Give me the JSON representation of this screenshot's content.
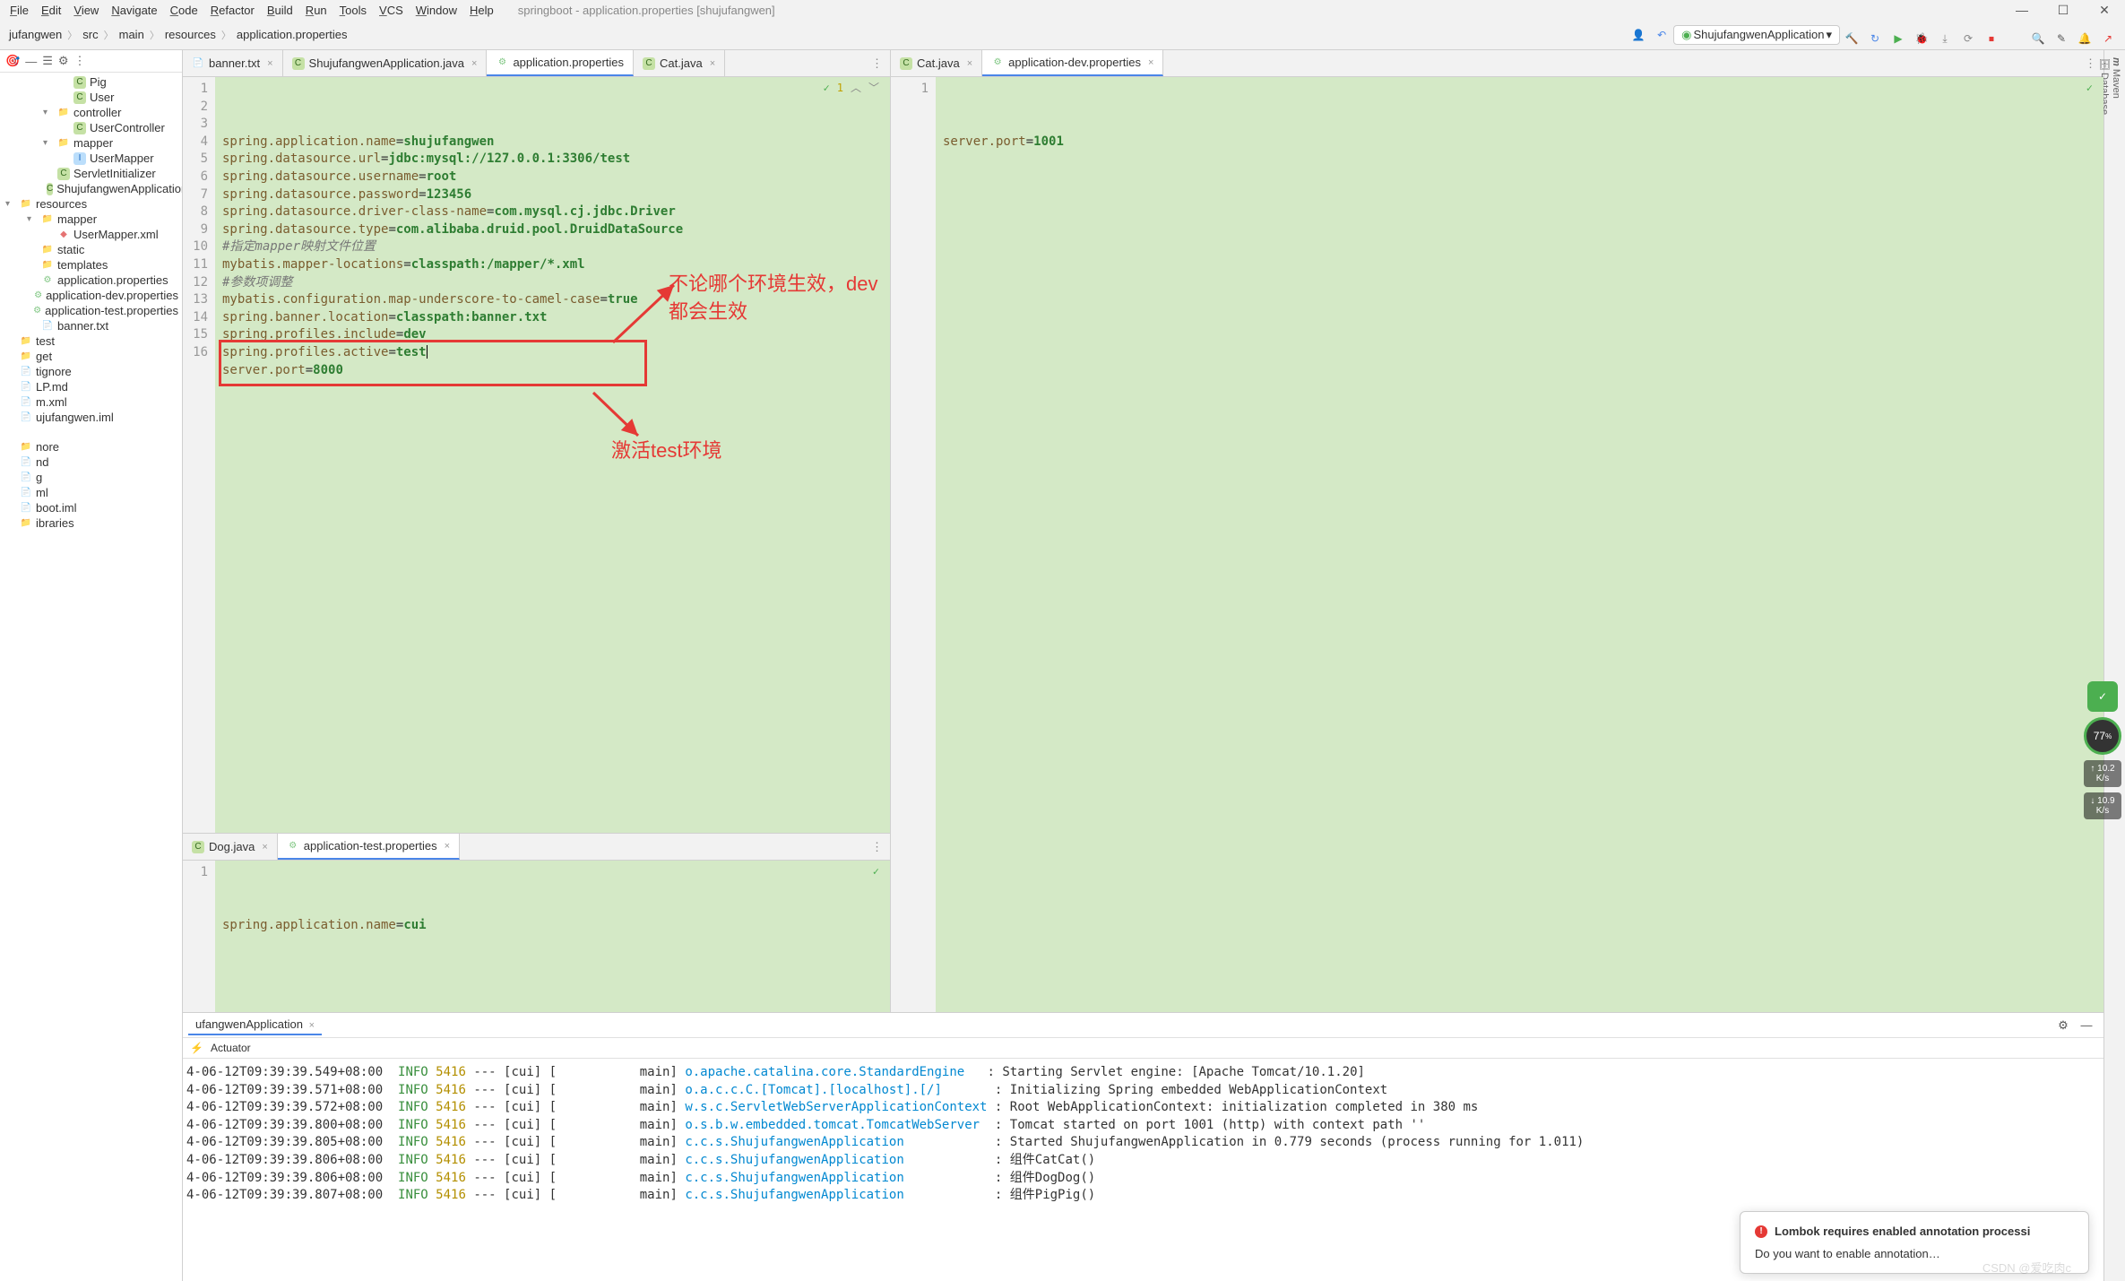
{
  "menu": {
    "items": [
      "File",
      "Edit",
      "View",
      "Navigate",
      "Code",
      "Refactor",
      "Build",
      "Run",
      "Tools",
      "VCS",
      "Window",
      "Help"
    ],
    "title": "springboot - application.properties [shujufangwen]"
  },
  "win_controls": {
    "min": "—",
    "max": "☐",
    "close": "✕"
  },
  "breadcrumbs": [
    "jufangwen",
    "src",
    "main",
    "resources",
    "application.properties"
  ],
  "run_config": {
    "icon": "▶",
    "label": "ShujufangwenApplication",
    "chev": "▾"
  },
  "tool_icons": [
    "🔨",
    "↻",
    "▶",
    "🐞",
    "⤓",
    "⟳",
    "⏹",
    "",
    "🔍",
    "✎",
    "🔔",
    "↗"
  ],
  "proj_tb": [
    "🎯",
    "—",
    "☰",
    "⚙",
    "⋮"
  ],
  "tree": [
    {
      "indent": 3,
      "chev": "",
      "icon": "C",
      "cls": "icon-class",
      "label": "Pig"
    },
    {
      "indent": 3,
      "chev": "",
      "icon": "C",
      "cls": "icon-class",
      "label": "User"
    },
    {
      "indent": 2,
      "chev": "▾",
      "icon": "📁",
      "cls": "icon-folder",
      "label": "controller"
    },
    {
      "indent": 3,
      "chev": "",
      "icon": "C",
      "cls": "icon-class",
      "label": "UserController"
    },
    {
      "indent": 2,
      "chev": "▾",
      "icon": "📁",
      "cls": "icon-folder",
      "label": "mapper"
    },
    {
      "indent": 3,
      "chev": "",
      "icon": "I",
      "cls": "icon-interface",
      "label": "UserMapper"
    },
    {
      "indent": 2,
      "chev": "",
      "icon": "C",
      "cls": "icon-class",
      "label": "ServletInitializer"
    },
    {
      "indent": 2,
      "chev": "",
      "icon": "C",
      "cls": "icon-class",
      "label": "ShujufangwenApplication"
    },
    {
      "indent": 0,
      "chev": "▾",
      "icon": "📁",
      "cls": "icon-folder",
      "label": "resources"
    },
    {
      "indent": 1,
      "chev": "▾",
      "icon": "📁",
      "cls": "icon-folder",
      "label": "mapper"
    },
    {
      "indent": 2,
      "chev": "",
      "icon": "◆",
      "cls": "icon-xml",
      "label": "UserMapper.xml"
    },
    {
      "indent": 1,
      "chev": "",
      "icon": "📁",
      "cls": "icon-folder",
      "label": "static"
    },
    {
      "indent": 1,
      "chev": "",
      "icon": "📁",
      "cls": "icon-folder",
      "label": "templates"
    },
    {
      "indent": 1,
      "chev": "",
      "icon": "⚙",
      "cls": "icon-prop",
      "label": "application.properties"
    },
    {
      "indent": 1,
      "chev": "",
      "icon": "⚙",
      "cls": "icon-prop",
      "label": "application-dev.properties"
    },
    {
      "indent": 1,
      "chev": "",
      "icon": "⚙",
      "cls": "icon-prop",
      "label": "application-test.properties"
    },
    {
      "indent": 1,
      "chev": "",
      "icon": "📄",
      "cls": "",
      "label": "banner.txt"
    },
    {
      "indent": 0,
      "chev": "",
      "icon": "📁",
      "cls": "icon-folder",
      "label": "test"
    },
    {
      "indent": 0,
      "chev": "",
      "icon": "📁",
      "cls": "icon-folder",
      "label": "get"
    },
    {
      "indent": 0,
      "chev": "",
      "icon": "📄",
      "cls": "",
      "label": "tignore"
    },
    {
      "indent": 0,
      "chev": "",
      "icon": "📄",
      "cls": "",
      "label": "LP.md"
    },
    {
      "indent": 0,
      "chev": "",
      "icon": "📄",
      "cls": "",
      "label": "m.xml"
    },
    {
      "indent": 0,
      "chev": "",
      "icon": "📄",
      "cls": "",
      "label": "ujufangwen.iml"
    },
    {
      "indent": 0,
      "chev": "",
      "icon": "",
      "cls": "",
      "label": ""
    },
    {
      "indent": 0,
      "chev": "",
      "icon": "📁",
      "cls": "icon-folder",
      "label": "nore"
    },
    {
      "indent": 0,
      "chev": "",
      "icon": "📄",
      "cls": "",
      "label": "nd"
    },
    {
      "indent": 0,
      "chev": "",
      "icon": "📄",
      "cls": "",
      "label": "g"
    },
    {
      "indent": 0,
      "chev": "",
      "icon": "📄",
      "cls": "",
      "label": "ml"
    },
    {
      "indent": 0,
      "chev": "",
      "icon": "📄",
      "cls": "",
      "label": "boot.iml"
    },
    {
      "indent": 0,
      "chev": "",
      "icon": "📁",
      "cls": "icon-folder",
      "label": "ibraries"
    }
  ],
  "tabs_left": [
    {
      "icon": "📄",
      "label": "banner.txt",
      "close": "×",
      "active": false
    },
    {
      "icon": "C",
      "label": "ShujufangwenApplication.java",
      "close": "×",
      "active": false
    },
    {
      "icon": "⚙",
      "label": "application.properties",
      "close": "",
      "active": true
    },
    {
      "icon": "C",
      "label": "Cat.java",
      "close": "×",
      "active": false
    }
  ],
  "tabs_right": [
    {
      "icon": "C",
      "label": "Cat.java",
      "close": "×",
      "active": false
    },
    {
      "icon": "⚙",
      "label": "application-dev.properties",
      "close": "×",
      "active": true
    }
  ],
  "tabs_dots": "⋮",
  "editor_main_status": {
    "check": "✓",
    "count": "1",
    "up": "︿",
    "down": "﹀"
  },
  "editor_main": {
    "gutter": [
      "1",
      "2",
      "3",
      "4",
      "5",
      "6",
      "7",
      "8",
      "9",
      "10",
      "11",
      "12",
      "13",
      "14",
      "15",
      "16"
    ],
    "lines": [
      {
        "key": "spring.application.name",
        "eq": "=",
        "val": "shujufangwen"
      },
      {
        "key": "spring.datasource.url",
        "eq": "=",
        "val": "jdbc:mysql://127.0.0.1:3306/test"
      },
      {
        "key": "spring.datasource.username",
        "eq": "=",
        "val": "root"
      },
      {
        "key": "spring.datasource.password",
        "eq": "=",
        "val": "123456"
      },
      {
        "key": "spring.datasource.driver-class-name",
        "eq": "=",
        "val": "com.mysql.cj.jdbc.Driver"
      },
      {
        "key": "spring.datasource.type",
        "eq": "=",
        "val": "com.alibaba.druid.pool.DruidDataSource"
      },
      {
        "comment": "#指定mapper映射文件位置"
      },
      {
        "key": "mybatis.mapper-locations",
        "eq": "=",
        "val": "classpath:/mapper/*.xml"
      },
      {
        "comment": "#参数项调整"
      },
      {
        "key": "mybatis.configuration.map-underscore-to-camel-case",
        "eq": "=",
        "val": "true"
      },
      {
        "key": "spring.banner.location",
        "eq": "=",
        "val": "classpath:banner.txt"
      },
      {
        "key": "spring.profiles.include",
        "eq": "=",
        "val": "dev"
      },
      {
        "key": "spring.profiles.active",
        "eq": "=",
        "val": "test",
        "cursor": true
      },
      {
        "key": "server.port",
        "eq": "=",
        "val": "8000"
      },
      {
        "blank": true
      },
      {
        "blank": true
      }
    ]
  },
  "annot": {
    "top": "不论哪个环境生效，dev都会生效",
    "bottom": "激活test环境"
  },
  "editor_right": {
    "gutter": [
      "1"
    ],
    "lines": [
      {
        "key": "server.port",
        "eq": "=",
        "val": "1001"
      }
    ]
  },
  "tabs_bottom": [
    {
      "icon": "C",
      "label": "Dog.java",
      "close": "×",
      "active": false
    },
    {
      "icon": "⚙",
      "label": "application-test.properties",
      "close": "×",
      "active": true
    }
  ],
  "editor_bottom": {
    "gutter": [
      "1"
    ],
    "lines": [
      {
        "key": "spring.application.name",
        "eq": "=",
        "val": "cui"
      }
    ]
  },
  "run_tab": {
    "label": "ufangwenApplication",
    "close": "×",
    "gear": "⚙",
    "minus": "—"
  },
  "actuator": {
    "icon": "⚡",
    "label": "Actuator"
  },
  "console_lines": [
    {
      "ts": "4-06-12T09:39:39.549+08:00",
      "lvl": "INFO",
      "pid": "5416",
      "thread": "--- [cui] [",
      "main": "           main] ",
      "logger": "o.apache.catalina.core.StandardEngine",
      "msg": "   : Starting Servlet engine: [Apache Tomcat/10.1.20]"
    },
    {
      "ts": "4-06-12T09:39:39.571+08:00",
      "lvl": "INFO",
      "pid": "5416",
      "thread": "--- [cui] [",
      "main": "           main] ",
      "logger": "o.a.c.c.C.[Tomcat].[localhost].[/]",
      "msg": "       : Initializing Spring embedded WebApplicationContext"
    },
    {
      "ts": "4-06-12T09:39:39.572+08:00",
      "lvl": "INFO",
      "pid": "5416",
      "thread": "--- [cui] [",
      "main": "           main] ",
      "logger": "w.s.c.ServletWebServerApplicationContext",
      "msg": " : Root WebApplicationContext: initialization completed in 380 ms"
    },
    {
      "ts": "4-06-12T09:39:39.800+08:00",
      "lvl": "INFO",
      "pid": "5416",
      "thread": "--- [cui] [",
      "main": "           main] ",
      "logger": "o.s.b.w.embedded.tomcat.TomcatWebServer",
      "msg": "  : Tomcat started on port 1001 (http) with context path ''"
    },
    {
      "ts": "4-06-12T09:39:39.805+08:00",
      "lvl": "INFO",
      "pid": "5416",
      "thread": "--- [cui] [",
      "main": "           main] ",
      "logger": "c.c.s.ShujufangwenApplication",
      "msg": "            : Started ShujufangwenApplication in 0.779 seconds (process running for 1.011)"
    },
    {
      "ts": "4-06-12T09:39:39.806+08:00",
      "lvl": "INFO",
      "pid": "5416",
      "thread": "--- [cui] [",
      "main": "           main] ",
      "logger": "c.c.s.ShujufangwenApplication",
      "msg": "            : 组件CatCat()"
    },
    {
      "ts": "4-06-12T09:39:39.806+08:00",
      "lvl": "INFO",
      "pid": "5416",
      "thread": "--- [cui] [",
      "main": "           main] ",
      "logger": "c.c.s.ShujufangwenApplication",
      "msg": "            : 组件DogDog()"
    },
    {
      "ts": "4-06-12T09:39:39.807+08:00",
      "lvl": "INFO",
      "pid": "5416",
      "thread": "--- [cui] [",
      "main": "           main] ",
      "logger": "c.c.s.ShujufangwenApplication",
      "msg": "            : 组件PigPig()"
    }
  ],
  "notification": {
    "title": "Lombok requires enabled annotation processi",
    "body": "Do you want to enable annotation…"
  },
  "watermark": "CSDN @爱吃肉c",
  "sidebar_right": [
    "Maven",
    "Database"
  ],
  "gauge": {
    "shield": "✓",
    "num": "77",
    "rate1": "10.2 K/s",
    "rate2": "10.9 K/s"
  }
}
